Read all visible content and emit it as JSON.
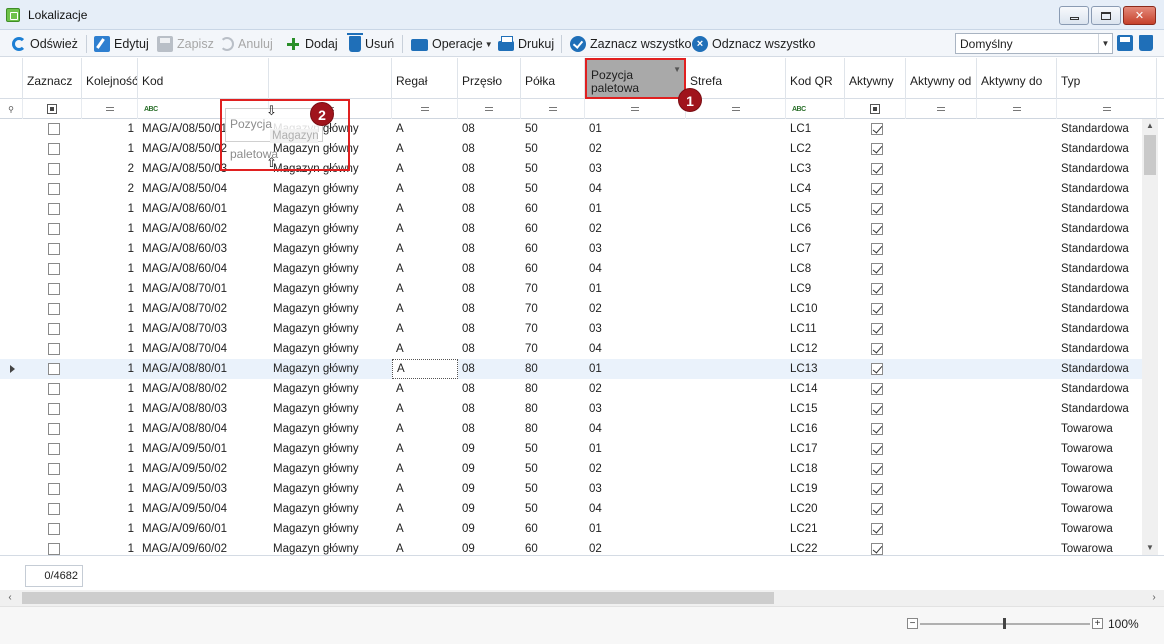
{
  "window": {
    "title": "Lokalizacje"
  },
  "toolbar": {
    "refresh": "Odśwież",
    "edit": "Edytuj",
    "save": "Zapisz",
    "cancel": "Anuluj",
    "add": "Dodaj",
    "delete": "Usuń",
    "operations": "Operacje",
    "print": "Drukuj",
    "select_all": "Zaznacz wszystko",
    "deselect_all": "Odznacz wszystko",
    "view_selected": "Domyślny"
  },
  "grid": {
    "columns": [
      "Zaznacz",
      "Kolejność",
      "Kod",
      "Magazyn",
      "Regał",
      "Przęsło",
      "Półka",
      "Pozycja paletowa",
      "Strefa",
      "Kod QR",
      "Aktywny",
      "Aktywny od",
      "Aktywny do",
      "Typ"
    ],
    "dragging_column": "Pozycja paletowa",
    "dragging_under": "Magazyn",
    "rows": [
      {
        "order": "1",
        "code": "MAG/A/08/50/01",
        "warehouse": "Magazyn główny",
        "rack": "A",
        "bay": "08",
        "shelf": "50",
        "pallet": "01",
        "zone": "",
        "qr": "LC1",
        "active": true,
        "type": "Standardowa"
      },
      {
        "order": "1",
        "code": "MAG/A/08/50/02",
        "warehouse": "Magazyn główny",
        "rack": "A",
        "bay": "08",
        "shelf": "50",
        "pallet": "02",
        "zone": "",
        "qr": "LC2",
        "active": true,
        "type": "Standardowa"
      },
      {
        "order": "2",
        "code": "MAG/A/08/50/03",
        "warehouse": "Magazyn główny",
        "rack": "A",
        "bay": "08",
        "shelf": "50",
        "pallet": "03",
        "zone": "",
        "qr": "LC3",
        "active": true,
        "type": "Standardowa"
      },
      {
        "order": "2",
        "code": "MAG/A/08/50/04",
        "warehouse": "Magazyn główny",
        "rack": "A",
        "bay": "08",
        "shelf": "50",
        "pallet": "04",
        "zone": "",
        "qr": "LC4",
        "active": true,
        "type": "Standardowa"
      },
      {
        "order": "1",
        "code": "MAG/A/08/60/01",
        "warehouse": "Magazyn główny",
        "rack": "A",
        "bay": "08",
        "shelf": "60",
        "pallet": "01",
        "zone": "",
        "qr": "LC5",
        "active": true,
        "type": "Standardowa"
      },
      {
        "order": "1",
        "code": "MAG/A/08/60/02",
        "warehouse": "Magazyn główny",
        "rack": "A",
        "bay": "08",
        "shelf": "60",
        "pallet": "02",
        "zone": "",
        "qr": "LC6",
        "active": true,
        "type": "Standardowa"
      },
      {
        "order": "1",
        "code": "MAG/A/08/60/03",
        "warehouse": "Magazyn główny",
        "rack": "A",
        "bay": "08",
        "shelf": "60",
        "pallet": "03",
        "zone": "",
        "qr": "LC7",
        "active": true,
        "type": "Standardowa"
      },
      {
        "order": "1",
        "code": "MAG/A/08/60/04",
        "warehouse": "Magazyn główny",
        "rack": "A",
        "bay": "08",
        "shelf": "60",
        "pallet": "04",
        "zone": "",
        "qr": "LC8",
        "active": true,
        "type": "Standardowa"
      },
      {
        "order": "1",
        "code": "MAG/A/08/70/01",
        "warehouse": "Magazyn główny",
        "rack": "A",
        "bay": "08",
        "shelf": "70",
        "pallet": "01",
        "zone": "",
        "qr": "LC9",
        "active": true,
        "type": "Standardowa"
      },
      {
        "order": "1",
        "code": "MAG/A/08/70/02",
        "warehouse": "Magazyn główny",
        "rack": "A",
        "bay": "08",
        "shelf": "70",
        "pallet": "02",
        "zone": "",
        "qr": "LC10",
        "active": true,
        "type": "Standardowa"
      },
      {
        "order": "1",
        "code": "MAG/A/08/70/03",
        "warehouse": "Magazyn główny",
        "rack": "A",
        "bay": "08",
        "shelf": "70",
        "pallet": "03",
        "zone": "",
        "qr": "LC11",
        "active": true,
        "type": "Standardowa"
      },
      {
        "order": "1",
        "code": "MAG/A/08/70/04",
        "warehouse": "Magazyn główny",
        "rack": "A",
        "bay": "08",
        "shelf": "70",
        "pallet": "04",
        "zone": "",
        "qr": "LC12",
        "active": true,
        "type": "Standardowa"
      },
      {
        "order": "1",
        "code": "MAG/A/08/80/01",
        "warehouse": "Magazyn główny",
        "rack": "A",
        "bay": "08",
        "shelf": "80",
        "pallet": "01",
        "zone": "",
        "qr": "LC13",
        "active": true,
        "type": "Standardowa",
        "selected": true
      },
      {
        "order": "1",
        "code": "MAG/A/08/80/02",
        "warehouse": "Magazyn główny",
        "rack": "A",
        "bay": "08",
        "shelf": "80",
        "pallet": "02",
        "zone": "",
        "qr": "LC14",
        "active": true,
        "type": "Standardowa"
      },
      {
        "order": "1",
        "code": "MAG/A/08/80/03",
        "warehouse": "Magazyn główny",
        "rack": "A",
        "bay": "08",
        "shelf": "80",
        "pallet": "03",
        "zone": "",
        "qr": "LC15",
        "active": true,
        "type": "Standardowa"
      },
      {
        "order": "1",
        "code": "MAG/A/08/80/04",
        "warehouse": "Magazyn główny",
        "rack": "A",
        "bay": "08",
        "shelf": "80",
        "pallet": "04",
        "zone": "",
        "qr": "LC16",
        "active": true,
        "type": "Towarowa"
      },
      {
        "order": "1",
        "code": "MAG/A/09/50/01",
        "warehouse": "Magazyn główny",
        "rack": "A",
        "bay": "09",
        "shelf": "50",
        "pallet": "01",
        "zone": "",
        "qr": "LC17",
        "active": true,
        "type": "Towarowa"
      },
      {
        "order": "1",
        "code": "MAG/A/09/50/02",
        "warehouse": "Magazyn główny",
        "rack": "A",
        "bay": "09",
        "shelf": "50",
        "pallet": "02",
        "zone": "",
        "qr": "LC18",
        "active": true,
        "type": "Towarowa"
      },
      {
        "order": "1",
        "code": "MAG/A/09/50/03",
        "warehouse": "Magazyn główny",
        "rack": "A",
        "bay": "09",
        "shelf": "50",
        "pallet": "03",
        "zone": "",
        "qr": "LC19",
        "active": true,
        "type": "Towarowa"
      },
      {
        "order": "1",
        "code": "MAG/A/09/50/04",
        "warehouse": "Magazyn główny",
        "rack": "A",
        "bay": "09",
        "shelf": "50",
        "pallet": "04",
        "zone": "",
        "qr": "LC20",
        "active": true,
        "type": "Towarowa"
      },
      {
        "order": "1",
        "code": "MAG/A/09/60/01",
        "warehouse": "Magazyn główny",
        "rack": "A",
        "bay": "09",
        "shelf": "60",
        "pallet": "01",
        "zone": "",
        "qr": "LC21",
        "active": true,
        "type": "Towarowa"
      },
      {
        "order": "1",
        "code": "MAG/A/09/60/02",
        "warehouse": "Magazyn główny",
        "rack": "A",
        "bay": "09",
        "shelf": "60",
        "pallet": "02",
        "zone": "",
        "qr": "LC22",
        "active": true,
        "type": "Towarowa"
      }
    ]
  },
  "footer": {
    "record_counter": "0/4682"
  },
  "annotations": {
    "badge1": "1",
    "badge2": "2"
  },
  "status": {
    "zoom": "100%"
  },
  "colors": {
    "highlight": "#e02020",
    "badge": "#a0141c",
    "accent": "#1f6fb8"
  }
}
